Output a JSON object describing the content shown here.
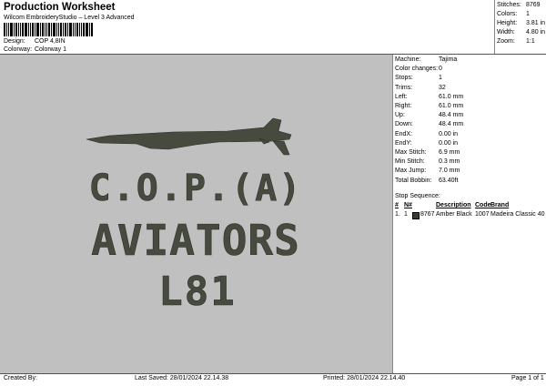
{
  "header": {
    "title": "Production Worksheet",
    "subtitle": "Wilcom EmbroideryStudio – Level 3 Advanced",
    "design_label": "Design:",
    "design_value": "COP 4,8IN",
    "colorway_label": "Colorway:",
    "colorway_value": "Colorway 1"
  },
  "stats": [
    {
      "label": "Stitches:",
      "value": "8769"
    },
    {
      "label": "Colors:",
      "value": "1"
    },
    {
      "label": "Height:",
      "value": "3.81 in"
    },
    {
      "label": "Width:",
      "value": "4.80 in"
    },
    {
      "label": "Zoom:",
      "value": "1:1"
    }
  ],
  "design": {
    "line1": "C.O.P.(A)",
    "line2": "AVIATORS",
    "line3": "L81",
    "thread_color": "#474a3f",
    "background_color": "#c0c0c0"
  },
  "machine_info": [
    {
      "label": "Machine:",
      "value": "Tajima"
    },
    {
      "label": "Color changes:",
      "value": "0"
    },
    {
      "label": "Stops:",
      "value": "1"
    },
    {
      "label": "Trims:",
      "value": "32"
    },
    {
      "label": "Left:",
      "value": "61.0 mm"
    },
    {
      "label": "Right:",
      "value": "61.0 mm"
    },
    {
      "label": "Up:",
      "value": "48.4 mm"
    },
    {
      "label": "Down:",
      "value": "48.4 mm"
    },
    {
      "label": "EndX:",
      "value": "0.00 in"
    },
    {
      "label": "EndY:",
      "value": "0.00 in"
    },
    {
      "label": "Max Stitch:",
      "value": "6.9 mm"
    },
    {
      "label": "Min Stitch:",
      "value": "0.3 mm"
    },
    {
      "label": "Max Jump:",
      "value": "7.0 mm"
    },
    {
      "label": "Total Bobbin:",
      "value": "63.40ft"
    }
  ],
  "stop_sequence": {
    "title": "Stop Sequence:",
    "headers": [
      "#",
      "N#",
      "Description",
      "Code",
      "Brand"
    ],
    "rows": [
      {
        "num": "1.",
        "n": "1",
        "stitches": "8767",
        "description": "Amber Black",
        "code": "1007",
        "brand": "Madeira Classic 40",
        "color": "#3a3a33"
      }
    ]
  },
  "footer": {
    "created_by": "Created By:",
    "last_saved": "Last Saved: 28/01/2024 22.14.38",
    "printed": "Printed: 28/01/2024 22.14.40",
    "page": "Page 1 of 1"
  }
}
